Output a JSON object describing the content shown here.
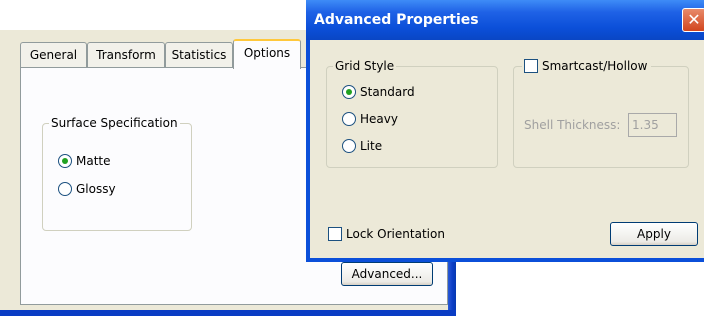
{
  "properties_window": {
    "tabs": [
      "General",
      "Transform",
      "Statistics",
      "Options"
    ],
    "active_tab": "Options",
    "surface_group": {
      "title": "Surface Specification",
      "options": [
        {
          "label": "Matte",
          "checked": true
        },
        {
          "label": "Glossy",
          "checked": false
        }
      ]
    },
    "advanced_button": "Advanced..."
  },
  "advanced_dialog": {
    "title": "Advanced Properties",
    "close_glyph": "✕",
    "grid_group": {
      "title": "Grid Style",
      "options": [
        {
          "label": "Standard",
          "checked": true
        },
        {
          "label": "Heavy",
          "checked": false
        },
        {
          "label": "Lite",
          "checked": false
        }
      ]
    },
    "smartcast_label": "Smartcast/Hollow",
    "smartcast_checked": false,
    "shell_thickness_label": "Shell Thickness:",
    "shell_thickness_value": "1.35",
    "lock_orientation_label": "Lock Orientation",
    "lock_orientation_checked": false,
    "apply_button": "Apply"
  },
  "colors": {
    "xp_blue": "#0a46c4",
    "dialog_face": "#ece9d8",
    "radio_dot": "#21a121",
    "tab_highlight": "#ffc83c"
  }
}
